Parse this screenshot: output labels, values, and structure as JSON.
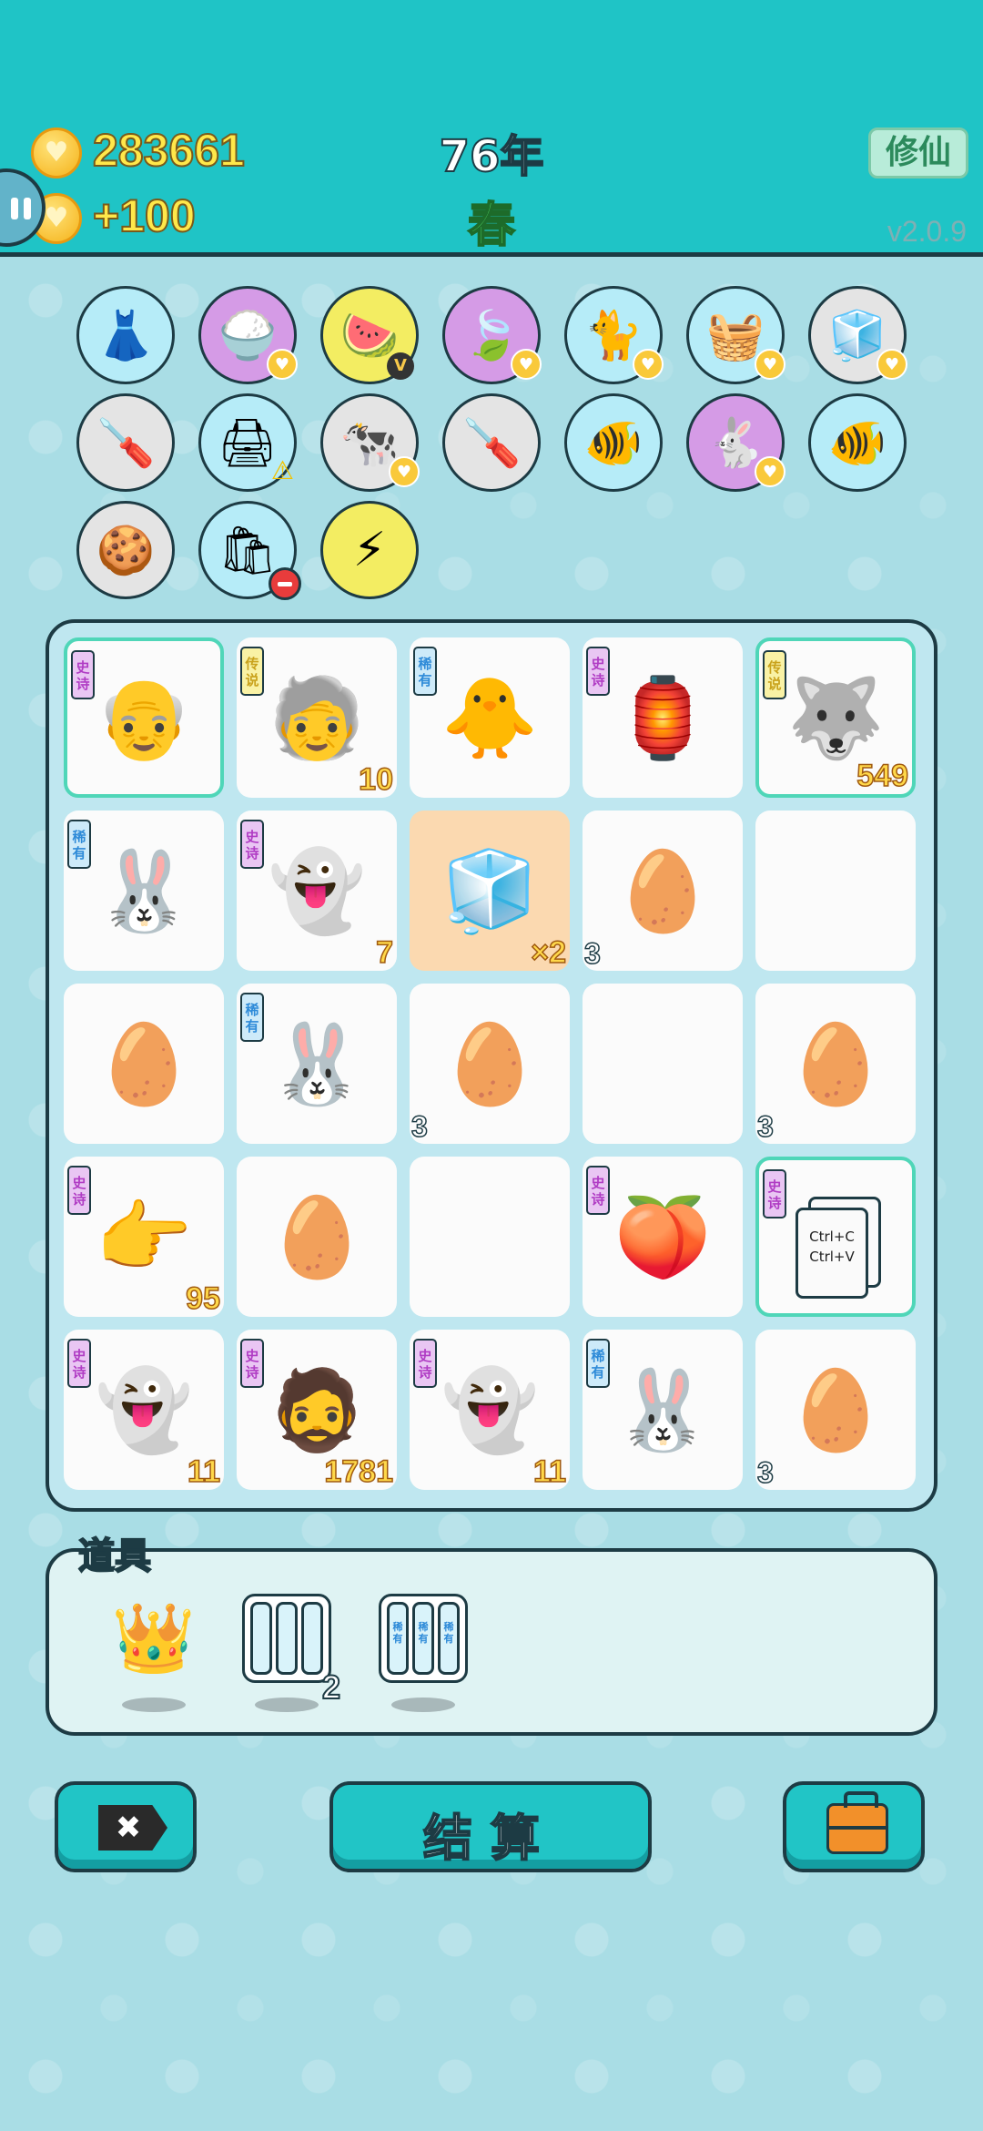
{
  "header": {
    "coins": "283661",
    "income": "+100",
    "year": "76年",
    "season": "春",
    "xiuxian_label": "修仙",
    "version": "v2.0.9"
  },
  "items_row1": [
    {
      "icon": "skirt-icon",
      "glyph": "👗",
      "color": "blue",
      "badge": ""
    },
    {
      "icon": "rice-bowl-icon",
      "glyph": "🍚",
      "color": "purple",
      "badge": "heart"
    },
    {
      "icon": "fruit-platter-icon",
      "glyph": "🍉",
      "color": "yellow",
      "badge": "v"
    },
    {
      "icon": "leaf-icon",
      "glyph": "🍃",
      "color": "purple",
      "badge": "heart"
    },
    {
      "icon": "cat-icon",
      "glyph": "🐈",
      "color": "blue",
      "badge": "heart"
    },
    {
      "icon": "fruit-basket-icon",
      "glyph": "🧺",
      "color": "blue",
      "badge": "heart"
    },
    {
      "icon": "sugar-cubes-icon",
      "glyph": "🧊",
      "color": "gray",
      "badge": "heart"
    }
  ],
  "items_row2": [
    {
      "icon": "screwdriver-icon",
      "glyph": "🪛",
      "color": "gray",
      "badge": ""
    },
    {
      "icon": "printer-icon",
      "glyph": "🖨",
      "color": "blue",
      "badge": "warn"
    },
    {
      "icon": "cows-icon",
      "glyph": "🐄",
      "color": "gray",
      "badge": "heart"
    },
    {
      "icon": "screwdriver-icon",
      "glyph": "🪛",
      "color": "gray",
      "badge": ""
    },
    {
      "icon": "fish-bowl-icon",
      "glyph": "🐠",
      "color": "blue",
      "badge": ""
    },
    {
      "icon": "rabbit-icon",
      "glyph": "🐇",
      "color": "purple",
      "badge": "heart"
    },
    {
      "icon": "fish-bowl-icon",
      "glyph": "🐠",
      "color": "blue",
      "badge": ""
    }
  ],
  "items_row3": [
    {
      "icon": "snack-pack-icon",
      "glyph": "🍪",
      "color": "gray",
      "badge": ""
    },
    {
      "icon": "trash-bag-icon",
      "glyph": "🛍",
      "color": "blue",
      "badge": "minus"
    },
    {
      "icon": "lightning-icon",
      "glyph": "⚡",
      "color": "yellow",
      "badge": ""
    }
  ],
  "board": [
    [
      {
        "name": "farmer-grandpa",
        "glyph": "👴",
        "rarity": "epic",
        "rarity_label": "史诗",
        "hl": true,
        "count": "",
        "count_pos": ""
      },
      {
        "name": "bald-grandpa",
        "glyph": "🧓",
        "rarity": "legend",
        "rarity_label": "传说",
        "hl": false,
        "count": "10",
        "count_pos": "r"
      },
      {
        "name": "chick",
        "glyph": "🐥",
        "rarity": "rare",
        "rarity_label": "稀有",
        "hl": false,
        "count": "",
        "count_pos": ""
      },
      {
        "name": "rabbit-house",
        "glyph": "🏮",
        "rarity": "epic",
        "rarity_label": "史诗",
        "hl": false,
        "count": "",
        "count_pos": ""
      },
      {
        "name": "husky-king",
        "glyph": "🐺",
        "rarity": "legend",
        "rarity_label": "传说",
        "hl": true,
        "count": "549",
        "count_pos": "r"
      }
    ],
    [
      {
        "name": "rabbit",
        "glyph": "🐰",
        "rarity": "rare",
        "rarity_label": "稀有",
        "hl": false,
        "count": "",
        "count_pos": ""
      },
      {
        "name": "ghost",
        "glyph": "👻",
        "rarity": "epic",
        "rarity_label": "史诗",
        "hl": false,
        "count": "7",
        "count_pos": "r"
      },
      {
        "name": "fridge",
        "glyph": "🧊",
        "rarity": "",
        "rarity_label": "",
        "hl": false,
        "orange": true,
        "count": "×2",
        "count_pos": "r"
      },
      {
        "name": "egg",
        "glyph": "🥚",
        "rarity": "",
        "rarity_label": "",
        "hl": false,
        "count": "3",
        "count_pos": "l"
      },
      {
        "name": "empty",
        "glyph": "",
        "rarity": "",
        "rarity_label": "",
        "hl": false,
        "count": "",
        "count_pos": ""
      }
    ],
    [
      {
        "name": "egg",
        "glyph": "🥚",
        "rarity": "",
        "rarity_label": "",
        "hl": false,
        "count": "",
        "count_pos": ""
      },
      {
        "name": "rabbit",
        "glyph": "🐰",
        "rarity": "rare",
        "rarity_label": "稀有",
        "hl": false,
        "count": "",
        "count_pos": ""
      },
      {
        "name": "egg",
        "glyph": "🥚",
        "rarity": "",
        "rarity_label": "",
        "hl": false,
        "count": "3",
        "count_pos": "l"
      },
      {
        "name": "empty",
        "glyph": "",
        "rarity": "",
        "rarity_label": "",
        "hl": false,
        "count": "",
        "count_pos": ""
      },
      {
        "name": "egg",
        "glyph": "🥚",
        "rarity": "",
        "rarity_label": "",
        "hl": false,
        "count": "3",
        "count_pos": "l"
      }
    ],
    [
      {
        "name": "pointing-hand",
        "glyph": "👉",
        "rarity": "epic",
        "rarity_label": "史诗",
        "hl": false,
        "count": "95",
        "count_pos": "r"
      },
      {
        "name": "egg",
        "glyph": "🥚",
        "rarity": "",
        "rarity_label": "",
        "hl": false,
        "count": "",
        "count_pos": ""
      },
      {
        "name": "empty",
        "glyph": "",
        "rarity": "",
        "rarity_label": "",
        "hl": false,
        "count": "",
        "count_pos": ""
      },
      {
        "name": "peach",
        "glyph": "🍑",
        "rarity": "epic",
        "rarity_label": "史诗",
        "hl": false,
        "count": "",
        "count_pos": ""
      },
      {
        "name": "ctrl-c-v",
        "glyph": "",
        "rarity": "epic",
        "rarity_label": "史诗",
        "hl": true,
        "count": "",
        "count_pos": "",
        "ctrl": true
      }
    ],
    [
      {
        "name": "ghost",
        "glyph": "👻",
        "rarity": "epic",
        "rarity_label": "史诗",
        "hl": false,
        "count": "11",
        "count_pos": "r"
      },
      {
        "name": "bearded-grandpa",
        "glyph": "🧔",
        "rarity": "epic",
        "rarity_label": "史诗",
        "hl": false,
        "count": "1781",
        "count_pos": "r"
      },
      {
        "name": "ghost",
        "glyph": "👻",
        "rarity": "epic",
        "rarity_label": "史诗",
        "hl": false,
        "count": "11",
        "count_pos": "r"
      },
      {
        "name": "rabbit",
        "glyph": "🐰",
        "rarity": "rare",
        "rarity_label": "稀有",
        "hl": false,
        "count": "",
        "count_pos": ""
      },
      {
        "name": "egg",
        "glyph": "🥚",
        "rarity": "",
        "rarity_label": "",
        "hl": false,
        "count": "3",
        "count_pos": "l"
      }
    ]
  ],
  "ctrl_card": {
    "line1": "Ctrl+C",
    "line2": "Ctrl+V"
  },
  "props": {
    "title": "道具",
    "crown_glyph": "👑",
    "slots_count": "2",
    "rare_slot_label": "稀有"
  },
  "buttons": {
    "close_label": "✖",
    "settle_label": "结算"
  },
  "colors": {
    "header_bg": "#1fc4c6",
    "page_bg": "#a9dde5",
    "coin_text": "#ffe84a",
    "season_text": "#58e06a",
    "epic": "#b03cc4",
    "rare": "#2d8ad8",
    "legend": "#c9a21c"
  }
}
